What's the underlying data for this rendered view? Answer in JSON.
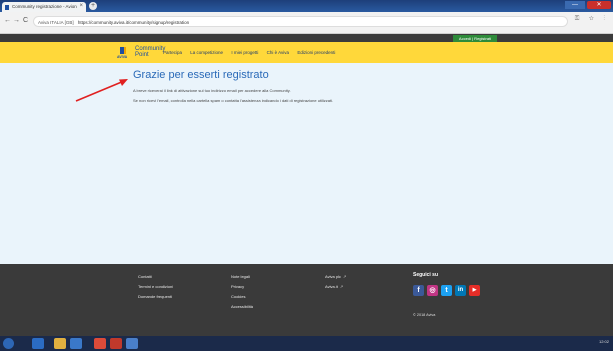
{
  "browser": {
    "tab_title": "Community registrazione - Avion ",
    "tab_close": "×",
    "new_tab": "+",
    "url_secure_label": "Aviva ITALIA [GB]",
    "url": "https://community.aviva.it/community/signup/registration",
    "nav_back": "←",
    "nav_forward": "→",
    "nav_reload": "C",
    "tools": "⚿ ☆ ⋮",
    "window_close": "✕",
    "window_minimize": "—"
  },
  "page": {
    "login_label": "Accedi | Registrati",
    "logo_brand": "AVIVA",
    "logo_name_line1": "Community",
    "logo_name_line2": "Point",
    "menu": [
      "Partecipa",
      "La competizione",
      "I miei progetti",
      "Chi è Aviva",
      "Edizioni precedenti"
    ],
    "title": "Grazie per esserti registrato",
    "paragraph1": "A breve riceverai il link di attivazione sul tuo indirizzo email per accedere alla Community.",
    "paragraph2": "Se non ricevi l'email, controlla nella cartella spam o contatta l'assistenza indicando i dati di registrazione utilizzati."
  },
  "footer": {
    "col1": [
      "Contatti",
      "Termini e condizioni",
      "Domande frequenti"
    ],
    "col2": [
      "Note legali",
      "Privacy",
      "Cookies",
      "Accessibilità"
    ],
    "col3": [
      "Aviva plc",
      "Aviva.it"
    ],
    "social_title": "Seguici su",
    "socials": [
      {
        "icon": "facebook-icon",
        "glyph": "f",
        "color": "#3b5998"
      },
      {
        "icon": "instagram-icon",
        "glyph": "◎",
        "color": "#c13584"
      },
      {
        "icon": "twitter-icon",
        "glyph": "t",
        "color": "#1da1f2"
      },
      {
        "icon": "linkedin-icon",
        "glyph": "in",
        "color": "#0077b5"
      },
      {
        "icon": "youtube-icon",
        "glyph": "▶",
        "color": "#e52d27"
      }
    ],
    "copyright": "© 2018 Aviva"
  },
  "taskbar": {
    "clock": "12:02"
  },
  "colors": {
    "accent_yellow": "#ffd83a",
    "title_blue": "#2a6ab8",
    "arrow_red": "#e02020"
  }
}
